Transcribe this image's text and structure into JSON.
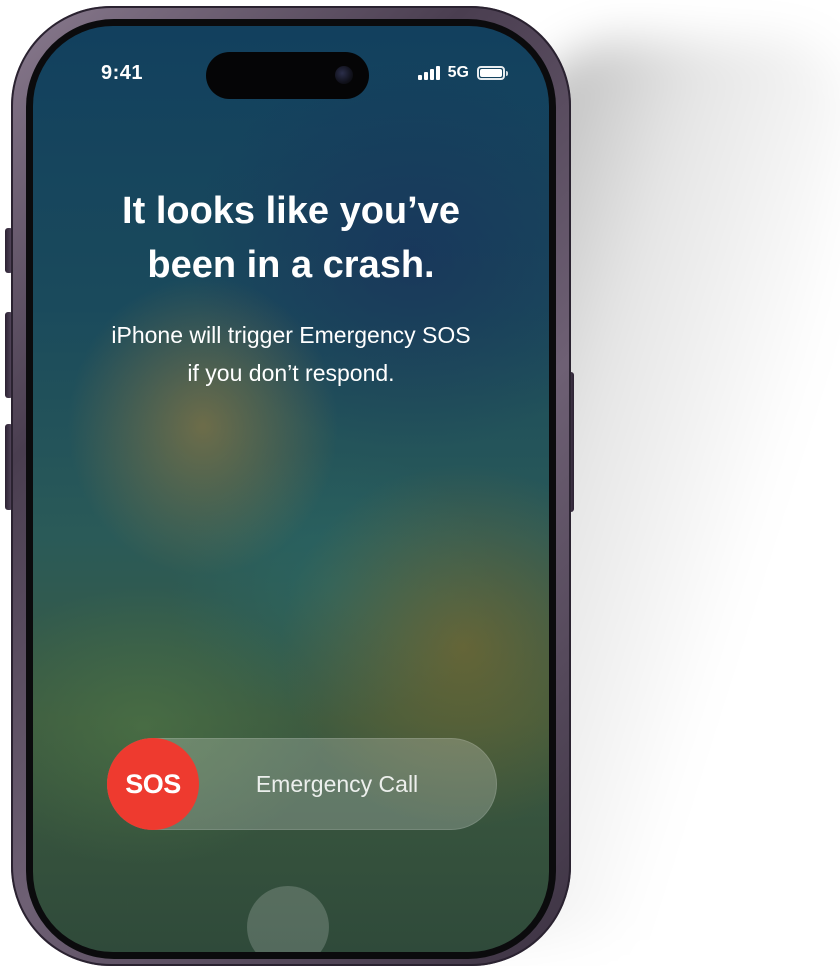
{
  "status_bar": {
    "time": "9:41",
    "network": "5G",
    "signal_icon": "cellular-signal-icon",
    "battery_icon": "battery-icon"
  },
  "alert": {
    "title": "It looks like you’ve\nbeen in a crash.",
    "message": "iPhone will trigger Emergency SOS\nif you don’t respond."
  },
  "emergency_slider": {
    "knob_label": "SOS",
    "slider_label": "Emergency Call",
    "knob_color": "#ee3a2f"
  }
}
